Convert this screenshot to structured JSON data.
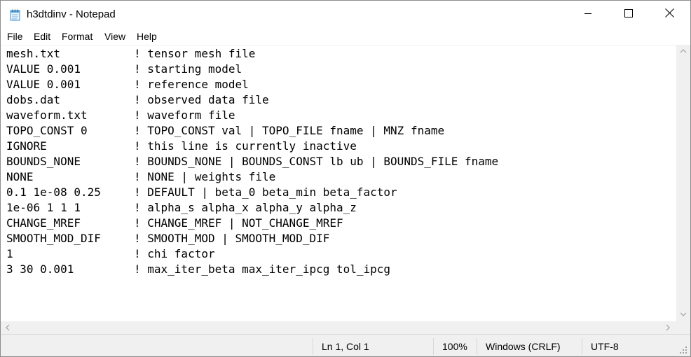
{
  "window": {
    "title": "h3dtdinv - Notepad",
    "app_icon": "notepad-icon",
    "controls": [
      "minimize-icon",
      "maximize-icon",
      "close-icon"
    ]
  },
  "menu": {
    "file": "File",
    "edit": "Edit",
    "format": "Format",
    "view": "View",
    "help": "Help"
  },
  "editor": {
    "lines": [
      {
        "value": "mesh.txt",
        "comment": "! tensor mesh file"
      },
      {
        "value": "VALUE 0.001",
        "comment": "! starting model"
      },
      {
        "value": "VALUE 0.001",
        "comment": "! reference model"
      },
      {
        "value": "dobs.dat",
        "comment": "! observed data file"
      },
      {
        "value": "waveform.txt",
        "comment": "! waveform file"
      },
      {
        "value": "TOPO_CONST 0",
        "comment": "! TOPO_CONST val | TOPO_FILE fname | MNZ fname"
      },
      {
        "value": "IGNORE",
        "comment": "! this line is currently inactive"
      },
      {
        "value": "BOUNDS_NONE",
        "comment": "! BOUNDS_NONE | BOUNDS_CONST lb ub | BOUNDS_FILE fname"
      },
      {
        "value": "NONE",
        "comment": "! NONE | weights file"
      },
      {
        "value": "0.1 1e-08 0.25",
        "comment": "! DEFAULT | beta_0 beta_min beta_factor"
      },
      {
        "value": "1e-06 1 1 1",
        "comment": "! alpha_s alpha_x alpha_y alpha_z"
      },
      {
        "value": "CHANGE_MREF",
        "comment": "! CHANGE_MREF | NOT_CHANGE_MREF"
      },
      {
        "value": "SMOOTH_MOD_DIF",
        "comment": "! SMOOTH_MOD | SMOOTH_MOD_DIF"
      },
      {
        "value": "1",
        "comment": "! chi factor"
      },
      {
        "value": "3 30 0.001",
        "comment": "! max_iter_beta max_iter_ipcg tol_ipcg"
      }
    ]
  },
  "statusbar": {
    "position": "Ln 1, Col 1",
    "zoom": "100%",
    "line_ending": "Windows (CRLF)",
    "encoding": "UTF-8"
  }
}
